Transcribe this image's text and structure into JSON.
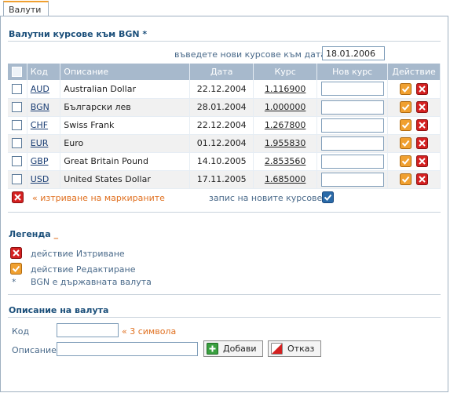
{
  "tab": {
    "label": "Валути"
  },
  "rates_section": {
    "title": "Валутни курсове към BGN *",
    "date_prompt": "въведете нови курсове към дата",
    "date_value": "18.01.2006"
  },
  "table": {
    "headers": {
      "code": "Код",
      "description": "Описание",
      "date": "Дата",
      "rate": "Курс",
      "new_rate": "Нов курс",
      "action": "Действие"
    },
    "rows": [
      {
        "code": "AUD",
        "description": "Australian Dollar",
        "date": "22.12.2004",
        "rate": "1.116900",
        "new_rate": ""
      },
      {
        "code": "BGN",
        "description": "Български лев",
        "date": "28.01.2004",
        "rate": "1.000000",
        "new_rate": ""
      },
      {
        "code": "CHF",
        "description": "Swiss Frank",
        "date": "22.12.2004",
        "rate": "1.267800",
        "new_rate": ""
      },
      {
        "code": "EUR",
        "description": "Euro",
        "date": "01.12.2004",
        "rate": "1.955830",
        "new_rate": ""
      },
      {
        "code": "GBP",
        "description": "Great Britain Pound",
        "date": "14.10.2005",
        "rate": "2.853560",
        "new_rate": ""
      },
      {
        "code": "USD",
        "description": "United States Dollar",
        "date": "17.11.2005",
        "rate": "1.685000",
        "new_rate": ""
      }
    ]
  },
  "table_footer": {
    "delete_marked": "« изтриване на маркираните",
    "save_new_rates": "запис на новите курсове"
  },
  "legend": {
    "title": "Легенда",
    "title_mark": "_",
    "delete_action": "действие Изтриване",
    "edit_action": "действие Редактиране",
    "asterisk": "*",
    "asterisk_note": "BGN е държавната валута"
  },
  "currency_form": {
    "title": "Описание на валута",
    "code_label": "Код",
    "code_value": "",
    "code_hint": "« 3 символа",
    "description_label": "Описание",
    "description_value": "",
    "add_button": "Добави",
    "cancel_button": "Отказ"
  },
  "colors": {
    "header_bg": "#a7b9cc",
    "section_title": "#1b4f7a",
    "accent_orange": "#e07020",
    "delete_red": "#d42020",
    "edit_orange": "#f0a030",
    "save_blue": "#2a6aa8"
  },
  "icons": {
    "delete": "delete-x-icon",
    "edit": "edit-check-icon",
    "save": "save-check-icon",
    "add": "add-plus-icon",
    "cancel": "cancel-icon"
  }
}
